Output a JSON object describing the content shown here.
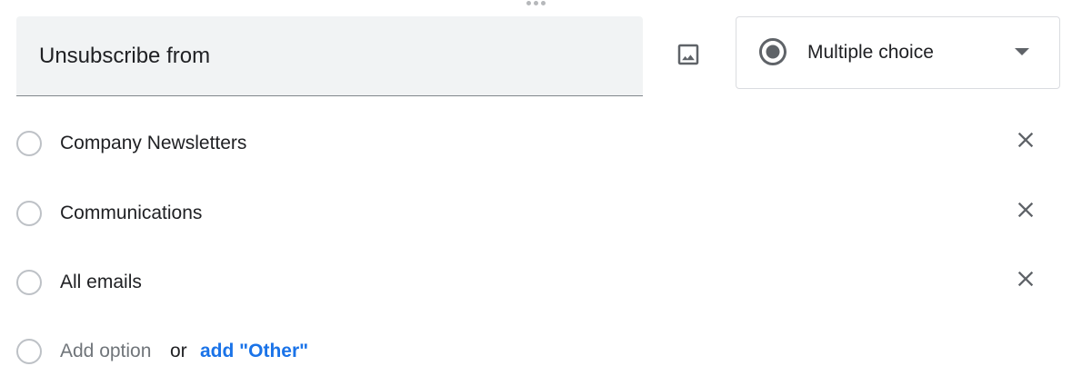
{
  "drag_handle": {
    "icon": "drag-dots-icon"
  },
  "question": {
    "title": "Unsubscribe from",
    "image_icon": "image-icon"
  },
  "question_type": {
    "selected": "Multiple choice",
    "icon": "radio-checked-icon",
    "caret_icon": "caret-down-icon"
  },
  "options": [
    {
      "label": "Company Newsletters",
      "remove_icon": "close-icon"
    },
    {
      "label": "Communications",
      "remove_icon": "close-icon"
    },
    {
      "label": "All emails",
      "remove_icon": "close-icon"
    }
  ],
  "add_option": {
    "placeholder": "Add option",
    "or_text": "or",
    "add_other_label": "add \"Other\""
  },
  "colors": {
    "field_background": "#f1f3f4",
    "link": "#1a73e8",
    "icon": "#5f6368",
    "radio_border": "#bdc1c6"
  }
}
